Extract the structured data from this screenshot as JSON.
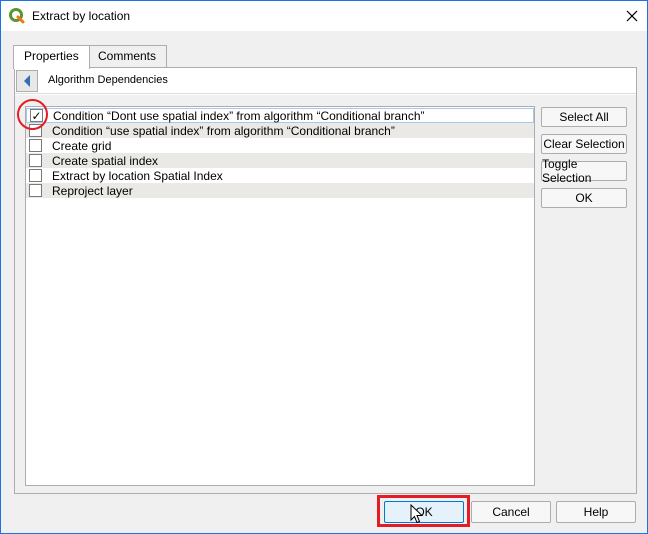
{
  "window": {
    "title": "Extract by location",
    "app_icon": "qgis-icon",
    "close_icon": "close-icon"
  },
  "tabs": [
    {
      "label": "Properties",
      "active": true
    },
    {
      "label": "Comments",
      "active": false
    }
  ],
  "subheader": {
    "back_icon": "back-arrow-icon",
    "title": "Algorithm Dependencies"
  },
  "dependencies": [
    {
      "label": "Condition “Dont use spatial index” from algorithm “Conditional branch”",
      "checked": true
    },
    {
      "label": "Condition “use spatial index” from algorithm “Conditional branch”",
      "checked": false
    },
    {
      "label": "Create grid",
      "checked": false
    },
    {
      "label": "Create spatial index",
      "checked": false
    },
    {
      "label": "Extract by location Spatial Index",
      "checked": false
    },
    {
      "label": "Reproject layer",
      "checked": false
    }
  ],
  "side_buttons": {
    "select_all": "Select All",
    "clear_selection": "Clear Selection",
    "toggle_selection": "Toggle Selection",
    "ok": "OK"
  },
  "footer_buttons": {
    "ok": "OK",
    "cancel": "Cancel",
    "help": "Help"
  },
  "colors": {
    "highlight": "#e31c25",
    "accent": "#0078d7",
    "qgis_green": "#589632"
  }
}
